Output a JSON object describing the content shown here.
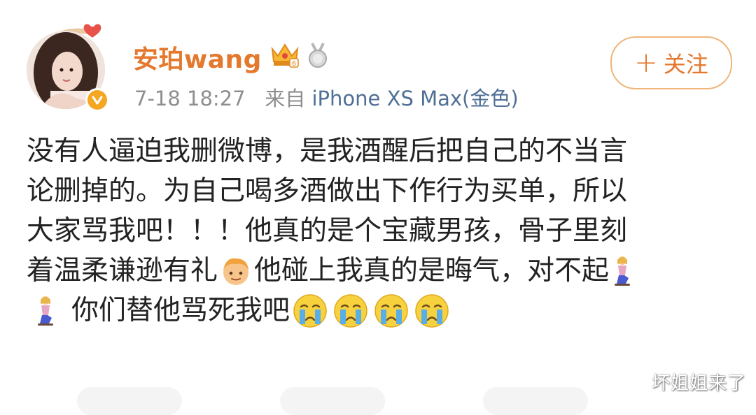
{
  "user": {
    "name": "安珀wang",
    "verified": true
  },
  "meta": {
    "time": "7-18 18:27",
    "from_label": "来自",
    "device": "iPhone XS Max(金色)"
  },
  "follow": {
    "plus": "+",
    "label": "关注"
  },
  "post": {
    "lines": [
      [
        "没有人逼迫我删微博，是我酒醒后把自己的不当言"
      ],
      [
        "论删掉的。为自己喝多酒做出下作行为买单，所以"
      ],
      [
        "大家骂我吧！！！他真的是个宝藏男孩，骨子里刻"
      ],
      [
        "着温柔谦逊有礼",
        "他碰上我真的是晦气，对不起"
      ],
      [
        "",
        "你们替他骂死我吧"
      ]
    ],
    "emojis": [
      "boy-face-emoji",
      "kneeling-woman-emoji",
      "crying-face-emoji"
    ]
  },
  "watermark": "坏姐姐来了",
  "colors": {
    "accent": "#e4782c",
    "link": "#4f6f95",
    "meta": "#8e8e8e",
    "verified": "#f5a623"
  }
}
